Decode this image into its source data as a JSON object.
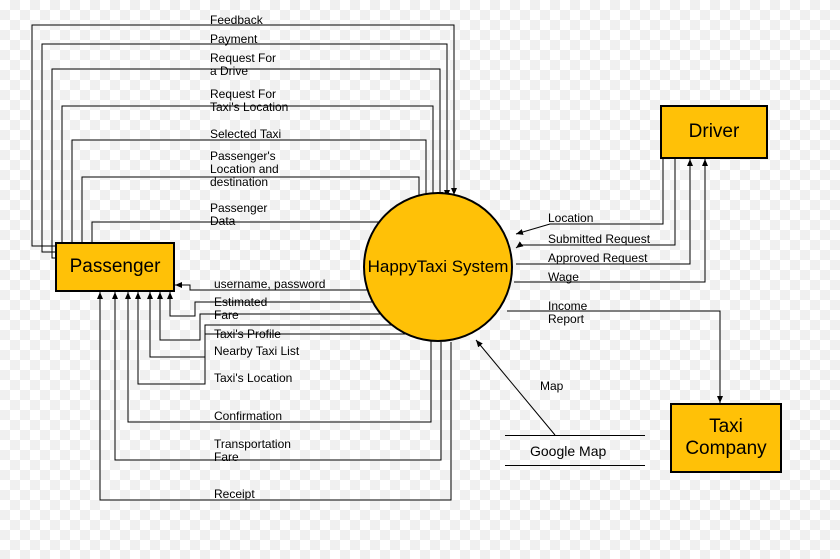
{
  "diagram": {
    "type": "context-diagram / DFD level-0",
    "process": {
      "name": "HappyTaxi System"
    },
    "externals": {
      "passenger": "Passenger",
      "driver": "Driver",
      "taxi_company": "Taxi Company",
      "google_map": "Google Map"
    },
    "flows": {
      "passenger_to_system": [
        "Feedback",
        "Payment",
        "Request For a Drive",
        "Request For Taxi's Location",
        "Selected Taxi",
        "Passenger's Location and destination",
        "Passenger Data"
      ],
      "system_to_passenger": [
        "username, password",
        "Estimated Fare",
        "Taxi's Profile",
        "Nearby Taxi List",
        "Taxi's Location",
        "Confirmation",
        "Transportation Fare",
        "Receipt"
      ],
      "driver_to_system": [
        "Location",
        "Submitted Request"
      ],
      "system_to_driver": [
        "Approved Request",
        "Wage"
      ],
      "system_to_company": [
        "Income Report"
      ],
      "googlemap_to_system": [
        "Map"
      ]
    },
    "colors": {
      "node_fill": "#ffc107",
      "stroke": "#000000"
    }
  }
}
